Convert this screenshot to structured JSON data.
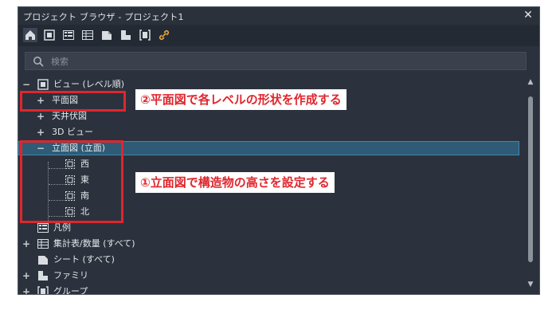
{
  "window": {
    "title": "プロジェクト ブラウザ - プロジェクト1",
    "close": "✕"
  },
  "toolbar": {
    "buttons": [
      {
        "name": "home-views-icon",
        "active": true
      },
      {
        "name": "view-frame-icon"
      },
      {
        "name": "legend-icon"
      },
      {
        "name": "schedule-icon"
      },
      {
        "name": "sheet-icon"
      },
      {
        "name": "family-icon"
      },
      {
        "name": "group-icon"
      },
      {
        "name": "link-icon"
      }
    ]
  },
  "search": {
    "placeholder": "検索",
    "value": ""
  },
  "tree": {
    "views_root": "ビュー (レベル順)",
    "floor_plan": "平面図",
    "ceiling_plan": "天井伏図",
    "view_3d": "3D ビュー",
    "elevations": "立面図 (立面)",
    "elev_west": "西",
    "elev_east": "東",
    "elev_south": "南",
    "elev_north": "北",
    "legends": "凡例",
    "schedules": "集計表/数量 (すべて)",
    "sheets": "シート (すべて)",
    "families": "ファミリ",
    "groups": "グループ"
  },
  "toggles": {
    "expanded": "−",
    "collapsed": "+"
  },
  "annotations": {
    "callout_2": "②平面図で各レベルの形状を作成する",
    "callout_1": "①立面図で構造物の高さを設定する"
  },
  "colors": {
    "accent_red": "#e0262d",
    "selection": "#2f5b76",
    "panel": "#2b323d"
  }
}
